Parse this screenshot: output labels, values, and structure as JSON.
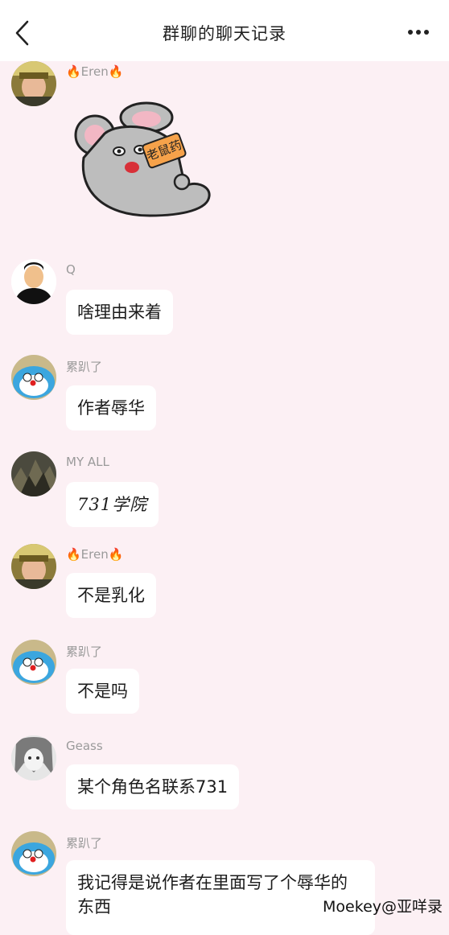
{
  "header": {
    "title": "群聊的聊天记录",
    "back_icon": "chevron-left-icon",
    "more_icon": "more-horizontal-icon"
  },
  "messages": [
    {
      "sender": "🔥Eren🔥",
      "type": "sticker",
      "sticker_text": "老鼠药"
    },
    {
      "sender": "Q",
      "text": "啥理由来着"
    },
    {
      "sender": "累趴了",
      "text": "作者辱华"
    },
    {
      "sender": "MY ALL",
      "text": "731学院"
    },
    {
      "sender": "🔥Eren🔥",
      "text": "不是乳化"
    },
    {
      "sender": "累趴了",
      "text": "不是吗"
    },
    {
      "sender": "Geass",
      "text": "某个角色名联系731"
    },
    {
      "sender": "累趴了",
      "text": "我记得是说作者在里面写了个辱华的东西"
    }
  ],
  "watermark": "Moekey@亚咩录"
}
